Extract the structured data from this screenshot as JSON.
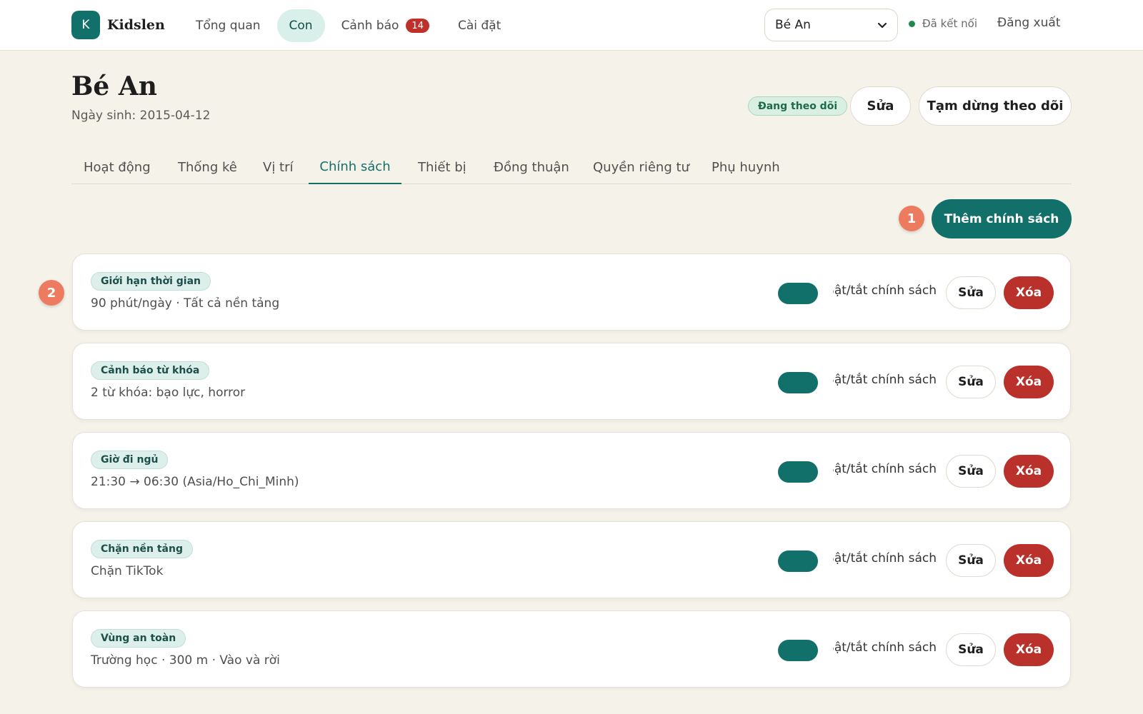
{
  "app": {
    "logo_letter": "K",
    "name": "Kidslen"
  },
  "nav": {
    "items": [
      {
        "label": "Tổng quan"
      },
      {
        "label": "Con",
        "active": true
      },
      {
        "label": "Cảnh báo",
        "badge": "14"
      },
      {
        "label": "Cài đặt"
      }
    ]
  },
  "child_select": {
    "value": "Bé An",
    "icon": "chevron-down-icon"
  },
  "connection": {
    "label": "Đã kết nối",
    "color": "#1f8a4d"
  },
  "logout_label": "Đăng xuất",
  "child": {
    "name": "Bé An",
    "dob": "Ngày sinh: 2015-04-12",
    "status": "Đang theo dõi"
  },
  "header_actions": {
    "edit_label": "Sửa",
    "pause_label": "Tạm dừng theo dõi"
  },
  "tabs": [
    {
      "label": "Hoạt động"
    },
    {
      "label": "Thống kê"
    },
    {
      "label": "Vị trí"
    },
    {
      "label": "Chính sách",
      "active": true
    },
    {
      "label": "Thiết bị"
    },
    {
      "label": "Đồng thuận"
    },
    {
      "label": "Quyền riêng tư"
    },
    {
      "label": "Phụ huynh"
    }
  ],
  "markers": [
    "1",
    "2"
  ],
  "add_policy_label": "Thêm chính sách",
  "policies": [
    {
      "type": "Giới hạn thời gian",
      "desc": "90 phút/ngày · Tất cả nền tảng",
      "enabled": true,
      "toggle_label": "Bật/tắt chính sách",
      "edit_label": "Sửa",
      "delete_label": "Xóa"
    },
    {
      "type": "Cảnh báo từ khóa",
      "desc": "2 từ khóa: bạo lực, horror",
      "enabled": true,
      "toggle_label": "Bật/tắt chính sách",
      "edit_label": "Sửa",
      "delete_label": "Xóa"
    },
    {
      "type": "Giờ đi ngủ",
      "desc": "21:30 → 06:30 (Asia/Ho_Chi_Minh)",
      "enabled": true,
      "toggle_label": "Bật/tắt chính sách",
      "edit_label": "Sửa",
      "delete_label": "Xóa"
    },
    {
      "type": "Chặn nền tảng",
      "desc": "Chặn TikTok",
      "enabled": true,
      "toggle_label": "Bật/tắt chính sách",
      "edit_label": "Sửa",
      "delete_label": "Xóa"
    },
    {
      "type": "Vùng an toàn",
      "desc": "Trường học · 300 m · Vào và rời",
      "enabled": true,
      "toggle_label": "Bật/tắt chính sách",
      "edit_label": "Sửa",
      "delete_label": "Xóa"
    }
  ],
  "colors": {
    "accent": "#12706a",
    "danger": "#b9312a",
    "marker": "#ec7b5f",
    "background": "#f5f2ea"
  }
}
